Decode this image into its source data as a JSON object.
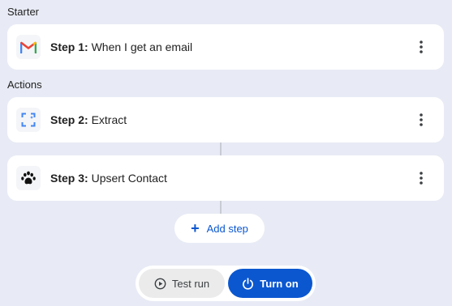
{
  "starter": {
    "section_label": "Starter",
    "steps": [
      {
        "prefix": "Step 1:",
        "text": "When I get an email",
        "icon": "gmail-icon"
      }
    ]
  },
  "actions": {
    "section_label": "Actions",
    "steps": [
      {
        "prefix": "Step 2:",
        "text": "Extract",
        "icon": "extract-icon"
      },
      {
        "prefix": "Step 3:",
        "text": "Upsert Contact",
        "icon": "paw-icon"
      }
    ]
  },
  "add_step": {
    "label": "Add step",
    "icon": "plus-icon"
  },
  "footer": {
    "test_run_label": "Test run",
    "turn_on_label": "Turn on"
  },
  "colors": {
    "background": "#e8ebf5",
    "accent": "#0b57d0",
    "card": "#ffffff"
  }
}
